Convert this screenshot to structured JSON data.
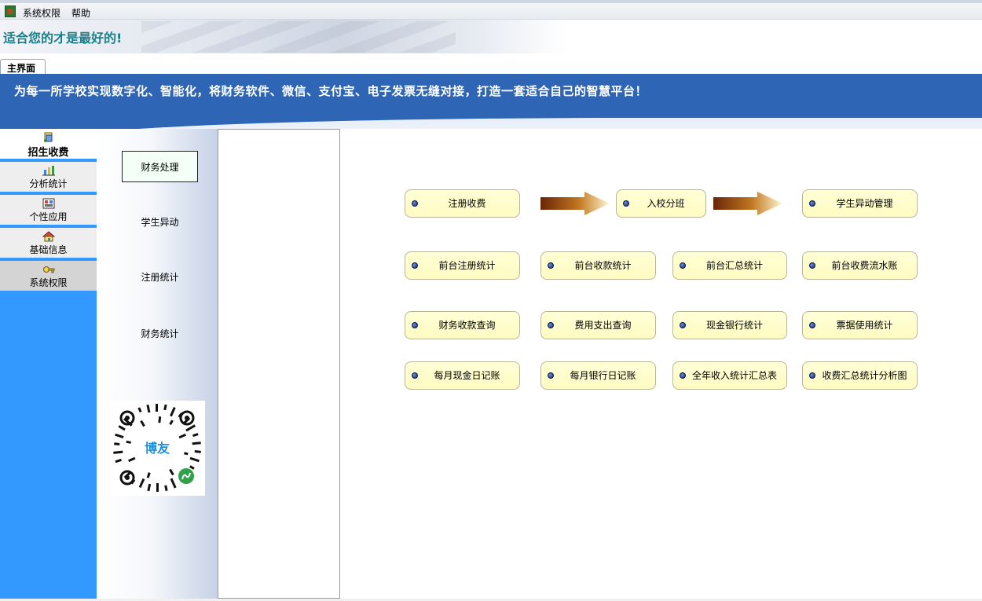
{
  "menubar": {
    "items": [
      "系统权限",
      "帮助"
    ]
  },
  "banner": {
    "title": "适合您的才是最好的!"
  },
  "tabs": [
    {
      "label": "主界面"
    }
  ],
  "header": {
    "slogan": "为每一所学校实现数字化、智能化，将财务软件、微信、支付宝、电子发票无缝对接，打造一套适合自己的智慧平台！"
  },
  "sidebar": {
    "items": [
      {
        "label": "招生收费",
        "icon": "receipt-icon",
        "active": true
      },
      {
        "label": "分析统计",
        "icon": "chart-icon"
      },
      {
        "label": "个性应用",
        "icon": "app-icon"
      },
      {
        "label": "基础信息",
        "icon": "home-icon"
      },
      {
        "label": "系统权限",
        "icon": "key-icon"
      }
    ]
  },
  "subnav": {
    "items": [
      "财务处理",
      "学生异动",
      "注册统计",
      "财务统计"
    ],
    "qr_text": "博友"
  },
  "main": {
    "flow": [
      "注册收费",
      "入校分班",
      "学生异动管理"
    ],
    "row2": [
      "前台注册统计",
      "前台收款统计",
      "前台汇总统计",
      "前台收费流水账"
    ],
    "row3": [
      "财务收款查询",
      "费用支出查询",
      "现金银行统计",
      "票据使用统计"
    ],
    "row4": [
      "每月现金日记账",
      "每月银行日记账",
      "全年收入统计汇总表",
      "收费汇总统计分析图"
    ]
  },
  "colors": {
    "header_blue": "#2e65b4",
    "sidebar_blue": "#3399ff",
    "button_fill": "#ffffd6",
    "banner_text": "#1b7f8a"
  }
}
